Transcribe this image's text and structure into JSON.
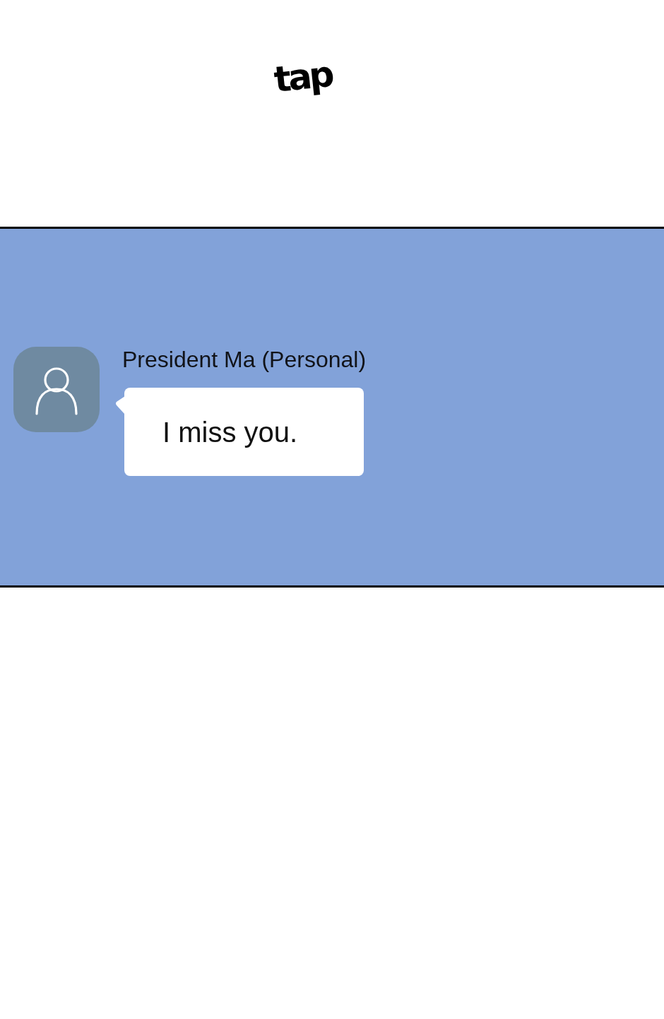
{
  "sound_effect": {
    "text": "tap"
  },
  "chat": {
    "sender": "President Ma (Personal)",
    "message": "I miss you."
  }
}
